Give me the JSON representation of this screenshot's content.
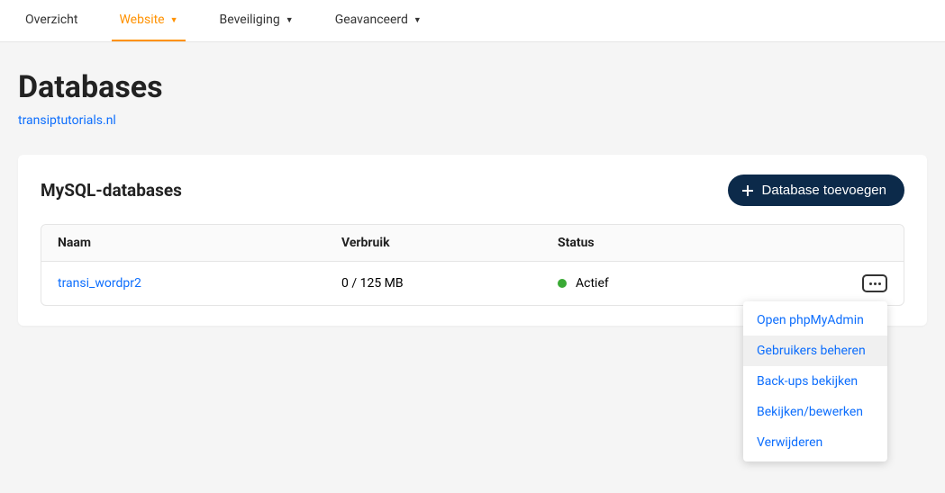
{
  "tabs": [
    {
      "label": "Overzicht",
      "hasCaret": false,
      "active": false
    },
    {
      "label": "Website",
      "hasCaret": true,
      "active": true
    },
    {
      "label": "Beveiliging",
      "hasCaret": true,
      "active": false
    },
    {
      "label": "Geavanceerd",
      "hasCaret": true,
      "active": false
    }
  ],
  "page": {
    "title": "Databases",
    "domain": "transiptutorials.nl"
  },
  "card": {
    "title": "MySQL-databases",
    "add_button": "Database toevoegen"
  },
  "table": {
    "headers": {
      "name": "Naam",
      "usage": "Verbruik",
      "status": "Status"
    },
    "rows": [
      {
        "name": "transi_wordpr2",
        "usage": "0 / 125 MB",
        "status": "Actief"
      }
    ]
  },
  "dropdown": {
    "items": [
      {
        "label": "Open phpMyAdmin",
        "hover": false
      },
      {
        "label": "Gebruikers beheren",
        "hover": true
      },
      {
        "label": "Back-ups bekijken",
        "hover": false
      },
      {
        "label": "Bekijken/bewerken",
        "hover": false
      },
      {
        "label": "Verwijderen",
        "hover": false
      }
    ]
  }
}
